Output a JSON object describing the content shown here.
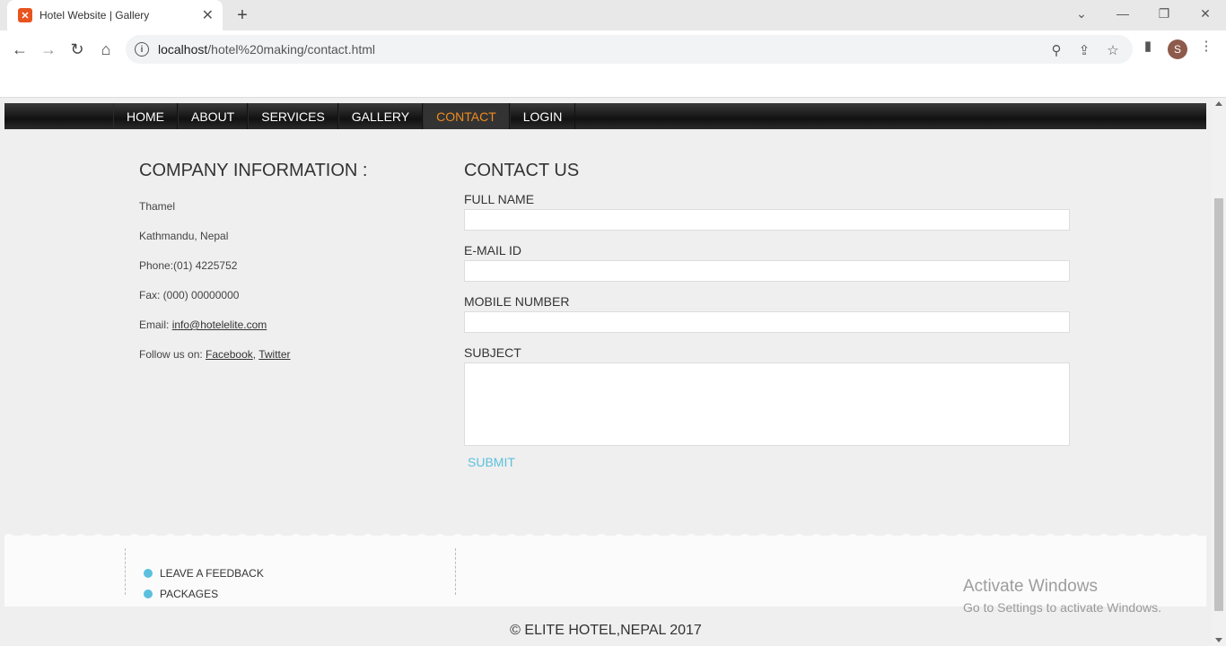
{
  "browser": {
    "tab_title": "Hotel Website | Gallery",
    "url_host": "localhost",
    "url_path": "/hotel%20making/contact.html",
    "profile_initial": "S"
  },
  "nav": {
    "items": [
      "HOME",
      "ABOUT",
      "SERVICES",
      "GALLERY",
      "CONTACT",
      "LOGIN"
    ],
    "active": "CONTACT"
  },
  "company": {
    "heading": "COMPANY INFORMATION :",
    "address1": "Thamel",
    "address2": "Kathmandu, Nepal",
    "phone": "Phone:(01) 4225752",
    "fax": "Fax: (000) 00000000",
    "email_label": "Email:",
    "email": "info@hotelelite.com",
    "follow_label": "Follow us on:",
    "facebook": "Facebook",
    "twitter": "Twitter"
  },
  "contact": {
    "heading": "CONTACT US",
    "full_name_label": "FULL NAME",
    "email_label": "E-MAIL ID",
    "mobile_label": "MOBILE NUMBER",
    "subject_label": "SUBJECT",
    "submit_label": "SUBMIT"
  },
  "footer": {
    "links": [
      "LEAVE A FEEDBACK",
      "PACKAGES"
    ],
    "copyright": "© ELITE HOTEL,NEPAL 2017"
  },
  "watermark": {
    "line1": "Activate Windows",
    "line2": "Go to Settings to activate Windows."
  },
  "colors": {
    "accent_active": "#f08c1e",
    "submit": "#5bc0de"
  }
}
